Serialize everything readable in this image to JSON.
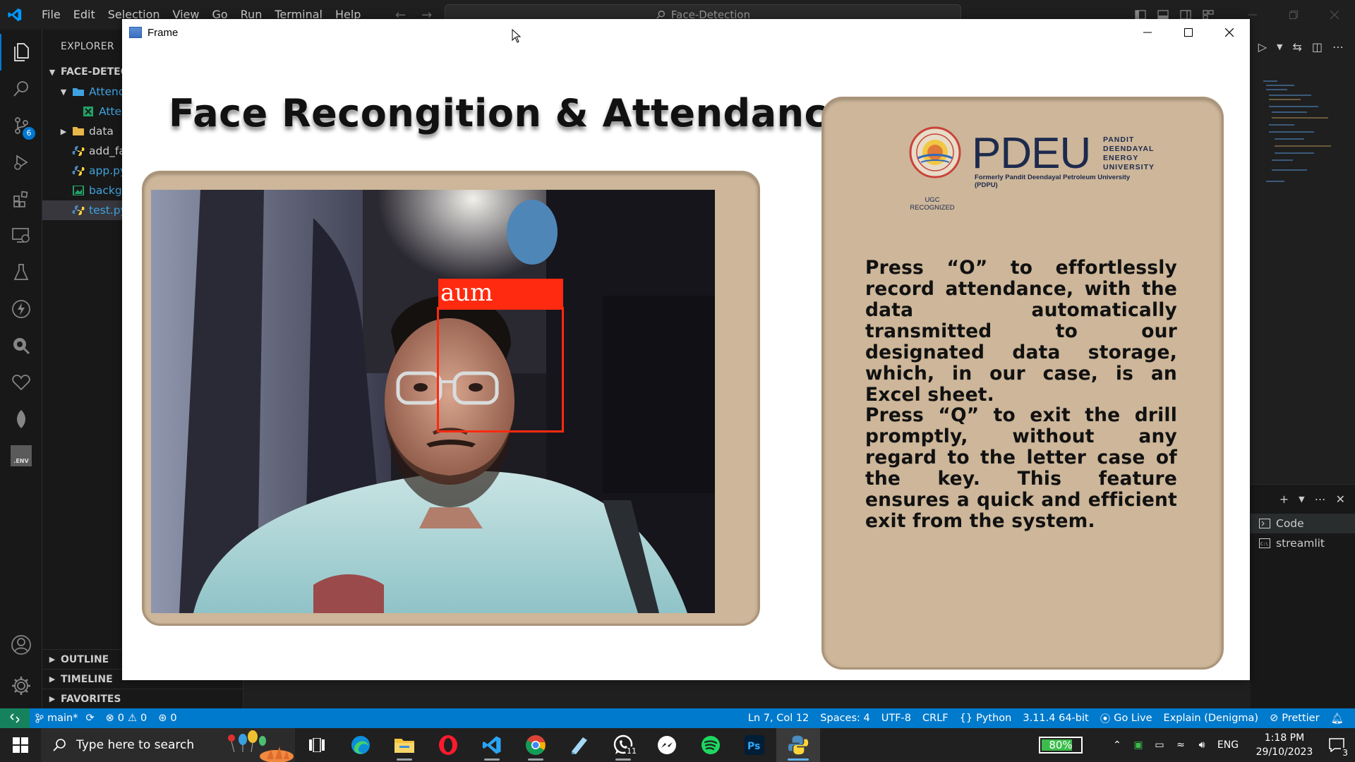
{
  "titlebar": {
    "menu": [
      "File",
      "Edit",
      "Selection",
      "View",
      "Go",
      "Run",
      "Terminal",
      "Help"
    ],
    "command_center": "Face-Detection"
  },
  "activity_bar": {
    "items": [
      "explorer-icon",
      "search-icon",
      "source-control-icon",
      "run-debug-icon",
      "extensions-icon",
      "remote-explorer-icon",
      "testing-icon",
      "lightning-icon",
      "search-replace-icon",
      "heart-icon",
      "leaf-icon",
      "env-icon"
    ],
    "scm_badge": "6",
    "env_label": ".ENV"
  },
  "sidebar": {
    "title": "EXPLORER",
    "root": "FACE-DETECT",
    "tree": [
      {
        "label": "Attend",
        "type": "folder-open",
        "indent": 1
      },
      {
        "label": "Atten",
        "type": "excel",
        "indent": 2
      },
      {
        "label": "data",
        "type": "folder",
        "indent": 1
      },
      {
        "label": "add_fa",
        "type": "python",
        "indent": 1
      },
      {
        "label": "app.py",
        "type": "python",
        "indent": 1
      },
      {
        "label": "backg",
        "type": "excel",
        "indent": 1
      },
      {
        "label": "test.py",
        "type": "python",
        "indent": 1
      }
    ],
    "sections": [
      "OUTLINE",
      "TIMELINE",
      "FAVORITES"
    ]
  },
  "terminal_panel": {
    "terminals": [
      "Code",
      "streamlit"
    ]
  },
  "statusbar": {
    "branch": "main*",
    "errors": "0",
    "warnings": "0",
    "ports": "0",
    "position": "Ln 7, Col 12",
    "spaces": "Spaces: 4",
    "encoding": "UTF-8",
    "eol": "CRLF",
    "language": "Python",
    "interpreter": "3.11.4 64-bit",
    "golive": "Go Live",
    "explain": "Explain (Denigma)",
    "prettier": "Prettier"
  },
  "frame_window": {
    "title": "Frame",
    "heading": "Face Recongition & Attendance",
    "detected_name": "aum",
    "logo": {
      "word": "PDEU",
      "side": [
        "PANDIT",
        "DEENDAYAL",
        "ENERGY",
        "UNIVERSITY"
      ],
      "subtitle": "Formerly Pandit Deendayal Petroleum University (PDPU)",
      "ugc": "UGC RECOGNIZED"
    },
    "instruction_1": "Press “O” to effortlessly record attendance, with the data automatically transmitted to our designated data storage, which, in our case, is an Excel sheet.",
    "instruction_2": "Press “Q” to exit the drill promptly, without any regard to the letter case of the key. This feature ensures a quick and efficient exit from the system."
  },
  "taskbar": {
    "search_placeholder": "Type here to search",
    "apps": [
      "task-view-icon",
      "edge-icon",
      "file-explorer-icon",
      "opera-icon",
      "vscode-icon",
      "chrome-icon",
      "notepad-icon",
      "whatsapp-icon",
      "messenger-icon",
      "spotify-icon",
      "photoshop-icon",
      "python-icon"
    ],
    "whatsapp_badge": "11",
    "battery": "80%",
    "battery_level": 0.8,
    "language": "ENG",
    "time": "1:18 PM",
    "date": "29/10/2023",
    "notifications": "3"
  },
  "colors": {
    "status_blue": "#007acc",
    "panel_tan": "#cdb699",
    "detect_red": "#ff2a10"
  }
}
